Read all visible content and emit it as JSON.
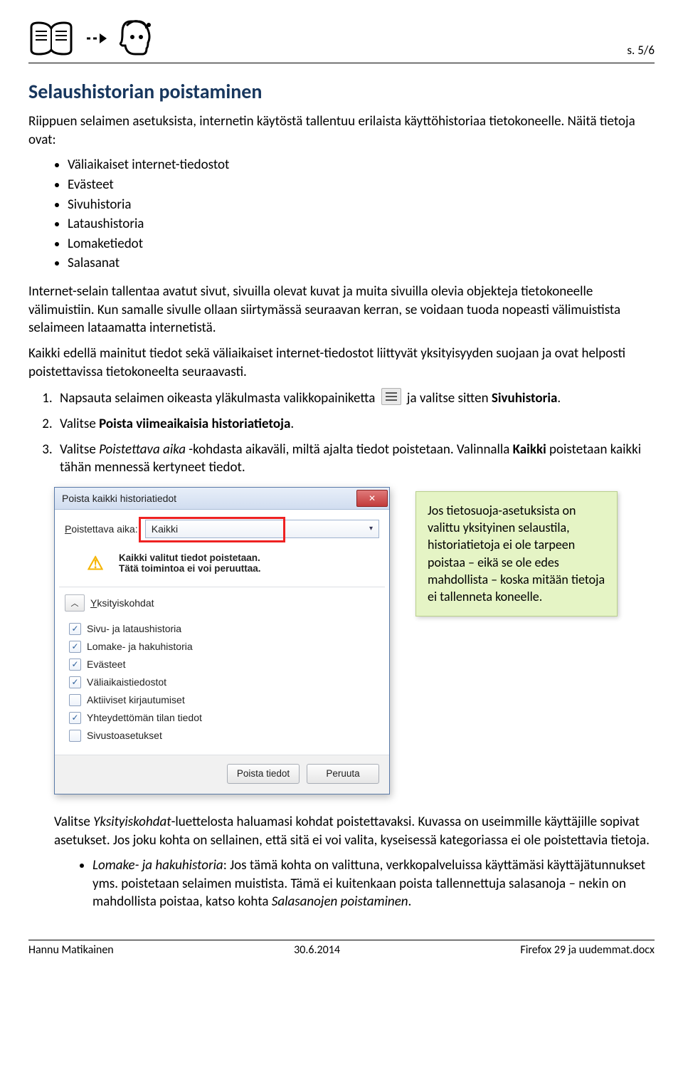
{
  "page_number": "s. 5/6",
  "section_heading": "Selaushistorian poistaminen",
  "intro": "Riippuen selaimen asetuksista, internetin käytöstä tallentuu erilaista käyttöhistoriaa tietokoneelle. Näitä tietoja ovat:",
  "bullets": [
    "Väliaikaiset internet-tiedostot",
    "Evästeet",
    "Sivuhistoria",
    "Lataushistoria",
    "Lomaketiedot",
    "Salasanat"
  ],
  "para2": "Internet-selain tallentaa avatut sivut, sivuilla olevat kuvat ja muita sivuilla olevia objekteja tietokoneelle välimuistiin. Kun samalle sivulle ollaan siirtymässä seuraavan kerran, se voidaan tuoda nopeasti välimuistista selaimeen lataamatta internetistä.",
  "para3": "Kaikki edellä mainitut tiedot sekä väliaikaiset internet-tiedostot liittyvät yksityisyyden suojaan ja ovat helposti poistettavissa tietokoneelta seuraavasti.",
  "steps": {
    "s1_pre": "Napsauta selaimen oikeasta yläkulmasta valikkopainiketta",
    "s1_post": "ja valitse sitten ",
    "s1_bold": "Sivuhistoria",
    "s1_end": ".",
    "s2_pre": "Valitse ",
    "s2_bold": "Poista viimeaikaisia historiatietoja",
    "s2_end": ".",
    "s3_pre": "Valitse ",
    "s3_italic": "Poistettava aika",
    "s3_mid": " -kohdasta aikaväli, miltä ajalta tiedot poistetaan. Valinnalla ",
    "s3_bold": "Kaikki",
    "s3_end": " poistetaan kaikki tähän mennessä kertyneet tiedot."
  },
  "dialog": {
    "title": "Poista kaikki historiatiedot",
    "time_label": "Poistettava aika:",
    "time_value": "Kaikki",
    "warn_line1": "Kaikki valitut tiedot poistetaan.",
    "warn_line2": "Tätä toimintoa ei voi peruuttaa.",
    "details_label": "Yksityiskohdat",
    "options": [
      {
        "label": "Sivu- ja lataushistoria",
        "checked": true
      },
      {
        "label": "Lomake- ja hakuhistoria",
        "checked": true
      },
      {
        "label": "Evästeet",
        "checked": true
      },
      {
        "label": "Väliaikaistiedostot",
        "checked": true
      },
      {
        "label": "Aktiiviset kirjautumiset",
        "checked": false
      },
      {
        "label": "Yhteydettömän tilan tiedot",
        "checked": true
      },
      {
        "label": "Sivustoasetukset",
        "checked": false
      }
    ],
    "btn_ok": "Poista tiedot",
    "btn_cancel": "Peruuta"
  },
  "note_box": "Jos tietosuoja-asetuksista on valittu yksityinen selaustila, historiatietoja ei ole tarpeen poistaa – eikä se ole edes mahdollista – koska mitään tietoja ei tallenneta koneelle.",
  "after1": "Valitse Yksityiskohdat-luettelosta haluamasi kohdat poistettavaksi. Kuvassa on useimmille käyttäjille sopivat asetukset. Jos joku kohta on sellainen, että sitä ei voi valita, kyseisessä kategoriassa ei ole poistettavia tietoja.",
  "after_bullet_italic": "Lomake- ja hakuhistoria",
  "after_bullet_rest": ": Jos tämä kohta on valittuna, verkkopalveluissa käyttämäsi käyttäjätunnukset yms. poistetaan selaimen muistista. Tämä ei kuitenkaan poista tallennettuja salasanoja – nekin on mahdollista poistaa, katso kohta ",
  "after_bullet_italic2": "Salasanojen poistaminen",
  "after_bullet_end": ".",
  "footer": {
    "left": "Hannu Matikainen",
    "center": "30.6.2014",
    "right": "Firefox 29 ja uudemmat.docx"
  }
}
